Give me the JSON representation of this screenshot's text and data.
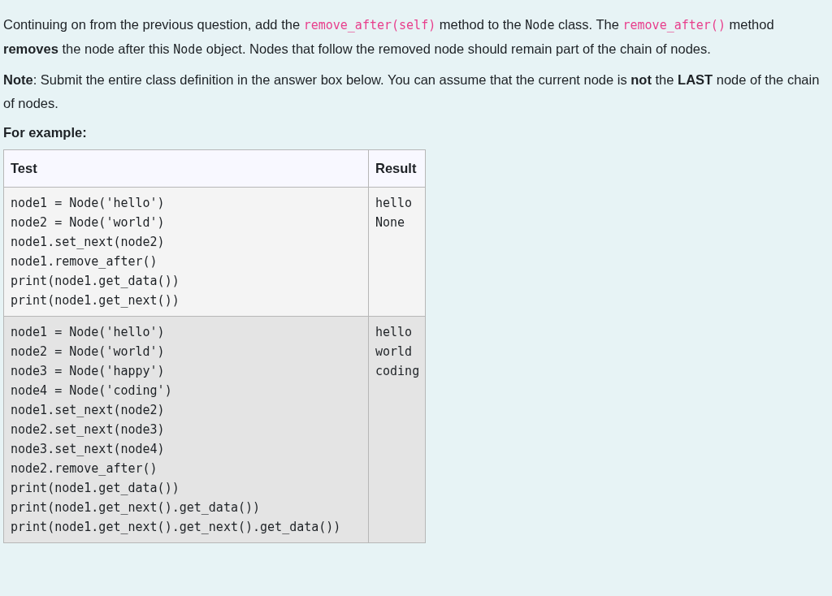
{
  "question": {
    "paragraphs": [
      [
        {
          "kind": "text",
          "text": "Continuing on from the previous question, add the "
        },
        {
          "kind": "code_highlight",
          "text": "remove_after(self)"
        },
        {
          "kind": "text",
          "text": " method to the "
        },
        {
          "kind": "code",
          "text": "Node"
        },
        {
          "kind": "text",
          "text": " class. The "
        },
        {
          "kind": "code_highlight",
          "text": "remove_after()"
        },
        {
          "kind": "text",
          "text": " method **removes** the node after this "
        },
        {
          "kind": "code",
          "text": "Node"
        },
        {
          "kind": "text",
          "text": " object. Nodes that follow the removed node should remain part of the chain of nodes."
        }
      ],
      [
        {
          "kind": "text",
          "text": "**Note**: Submit the entire class definition in the answer box below. You can assume that the current node is **not** the **LAST** node of the chain of nodes."
        }
      ]
    ],
    "example_heading": "For example:",
    "table": {
      "columns": [
        "Test",
        "Result"
      ],
      "rows": [
        {
          "test": [
            "node1 = Node('hello')",
            "node2 = Node('world')",
            "node1.set_next(node2)",
            "node1.remove_after()",
            "print(node1.get_data())",
            "print(node1.get_next())"
          ],
          "result": [
            "hello",
            "None"
          ]
        },
        {
          "test": [
            "node1 = Node('hello')",
            "node2 = Node('world')",
            "node3 = Node('happy')",
            "node4 = Node('coding')",
            "node1.set_next(node2)",
            "node2.set_next(node3)",
            "node3.set_next(node4)",
            "node2.remove_after()",
            "print(node1.get_data())",
            "print(node1.get_next().get_data())",
            "print(node1.get_next().get_next().get_data())"
          ],
          "result": [
            "hello",
            "world",
            "coding"
          ]
        }
      ]
    }
  }
}
